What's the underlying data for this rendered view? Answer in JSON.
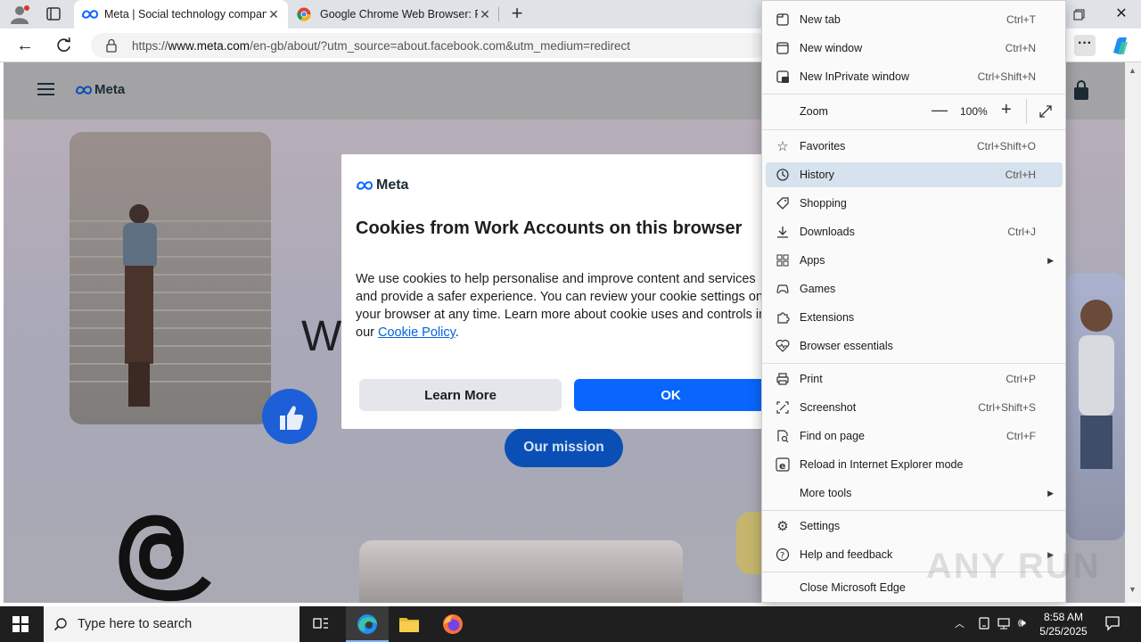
{
  "tabs": [
    {
      "title": "Meta | Social technology compan",
      "icon": "meta-icon"
    },
    {
      "title": "Google Chrome Web Browser: Fi",
      "icon": "chrome-icon"
    }
  ],
  "address": {
    "url_prefix": "https://",
    "url_host": "www.meta.com",
    "url_path": "/en-gb/about/?utm_source=about.facebook.com&utm_medium=redirect"
  },
  "page": {
    "logo": "Meta",
    "headline_fragment": "W",
    "mission_button": "Our mission"
  },
  "dialog": {
    "logo": "Meta",
    "title": "Cookies from Work Accounts on this browser",
    "body": "We use cookies to help personalise and improve content and services and provide a safer experience. You can review your cookie settings on your browser at any time. Learn more about cookie uses and controls in our ",
    "link": "Cookie Policy",
    "link_suffix": ".",
    "learn_more": "Learn More",
    "ok": "OK"
  },
  "menu": {
    "new_tab": {
      "label": "New tab",
      "shortcut": "Ctrl+T"
    },
    "new_window": {
      "label": "New window",
      "shortcut": "Ctrl+N"
    },
    "inprivate": {
      "label": "New InPrivate window",
      "shortcut": "Ctrl+Shift+N"
    },
    "zoom": {
      "label": "Zoom",
      "value": "100%"
    },
    "favorites": {
      "label": "Favorites",
      "shortcut": "Ctrl+Shift+O"
    },
    "history": {
      "label": "History",
      "shortcut": "Ctrl+H"
    },
    "shopping": {
      "label": "Shopping",
      "shortcut": ""
    },
    "downloads": {
      "label": "Downloads",
      "shortcut": "Ctrl+J"
    },
    "apps": {
      "label": "Apps",
      "shortcut": ""
    },
    "games": {
      "label": "Games",
      "shortcut": ""
    },
    "extensions": {
      "label": "Extensions",
      "shortcut": ""
    },
    "essentials": {
      "label": "Browser essentials",
      "shortcut": ""
    },
    "print": {
      "label": "Print",
      "shortcut": "Ctrl+P"
    },
    "screenshot": {
      "label": "Screenshot",
      "shortcut": "Ctrl+Shift+S"
    },
    "find": {
      "label": "Find on page",
      "shortcut": "Ctrl+F"
    },
    "ie_mode": {
      "label": "Reload in Internet Explorer mode",
      "shortcut": ""
    },
    "more_tools": {
      "label": "More tools",
      "shortcut": ""
    },
    "settings": {
      "label": "Settings",
      "shortcut": ""
    },
    "help": {
      "label": "Help and feedback",
      "shortcut": ""
    },
    "close": {
      "label": "Close Microsoft Edge",
      "shortcut": ""
    }
  },
  "taskbar": {
    "search_placeholder": "Type here to search",
    "time": "8:58 AM",
    "date": "5/25/2025"
  },
  "watermark": "ANY RUN",
  "colors": {
    "accent": "#0866ff",
    "mission": "#0a4fb5",
    "history_highlight": "#d6e3ee"
  }
}
